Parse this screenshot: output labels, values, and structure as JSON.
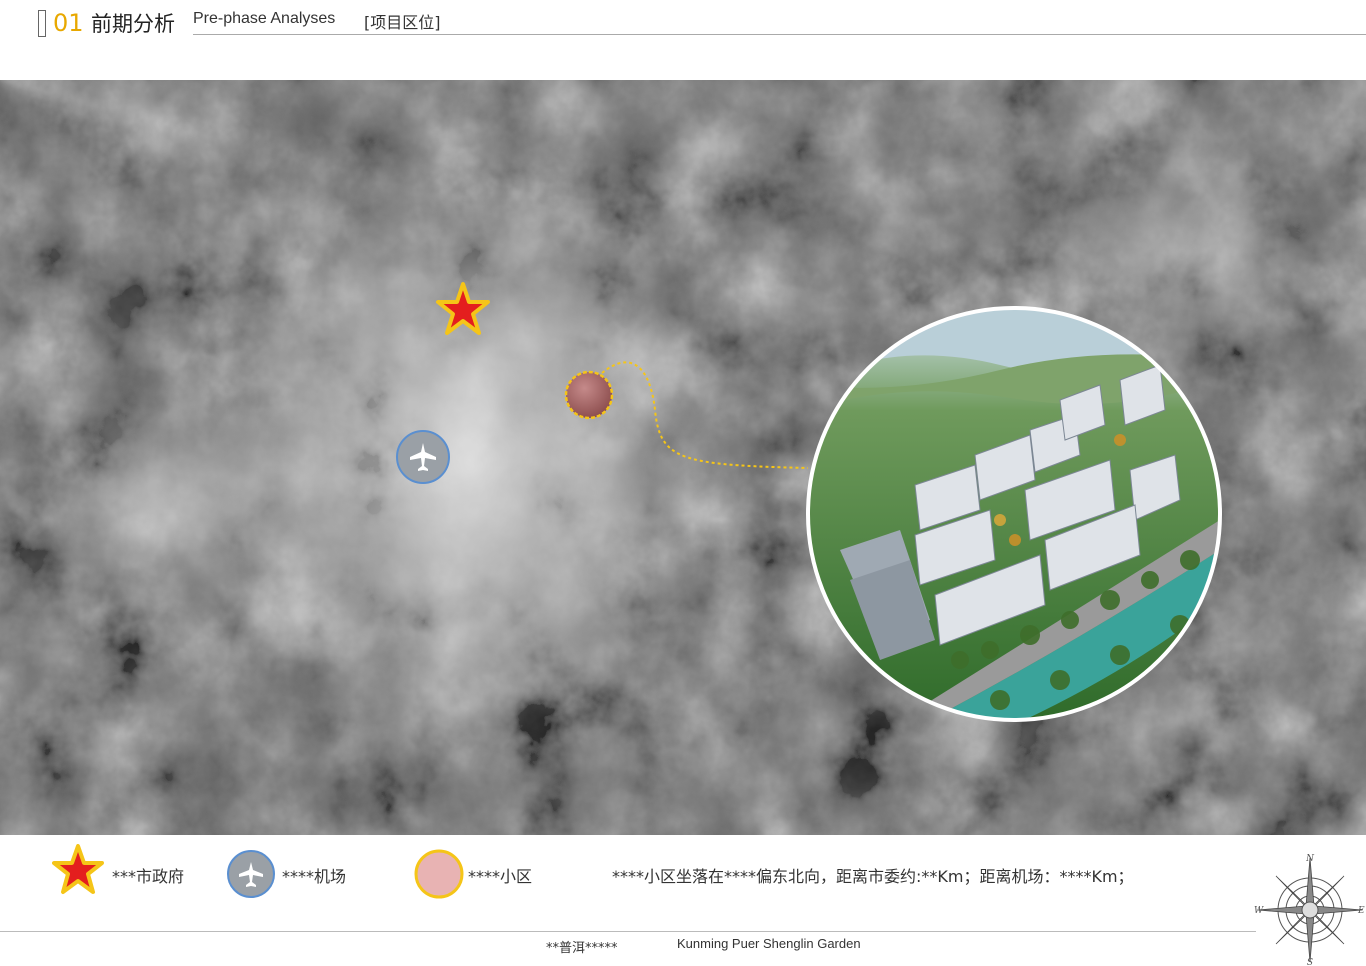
{
  "header": {
    "number": "01",
    "title_cn": "前期分析",
    "title_en": "Pre-phase Analyses",
    "tag": "[项目区位]"
  },
  "map": {
    "marker_icons": [
      "star-icon",
      "airplane-icon",
      "pink-dot-icon"
    ],
    "accent_color": "#f5c518",
    "star_color": "#e41e1e"
  },
  "legend": {
    "government": "***市政府",
    "airport": "****机场",
    "community": "****小区",
    "description": "****小区坐落在****偏东北向，距离市委约:**Km；距离机场：****Km；"
  },
  "footer": {
    "left": "**普洱*****",
    "right": "Kunming Puer Shenglin Garden"
  },
  "compass": {
    "n": "N",
    "s": "S",
    "e": "E",
    "w": "W"
  }
}
